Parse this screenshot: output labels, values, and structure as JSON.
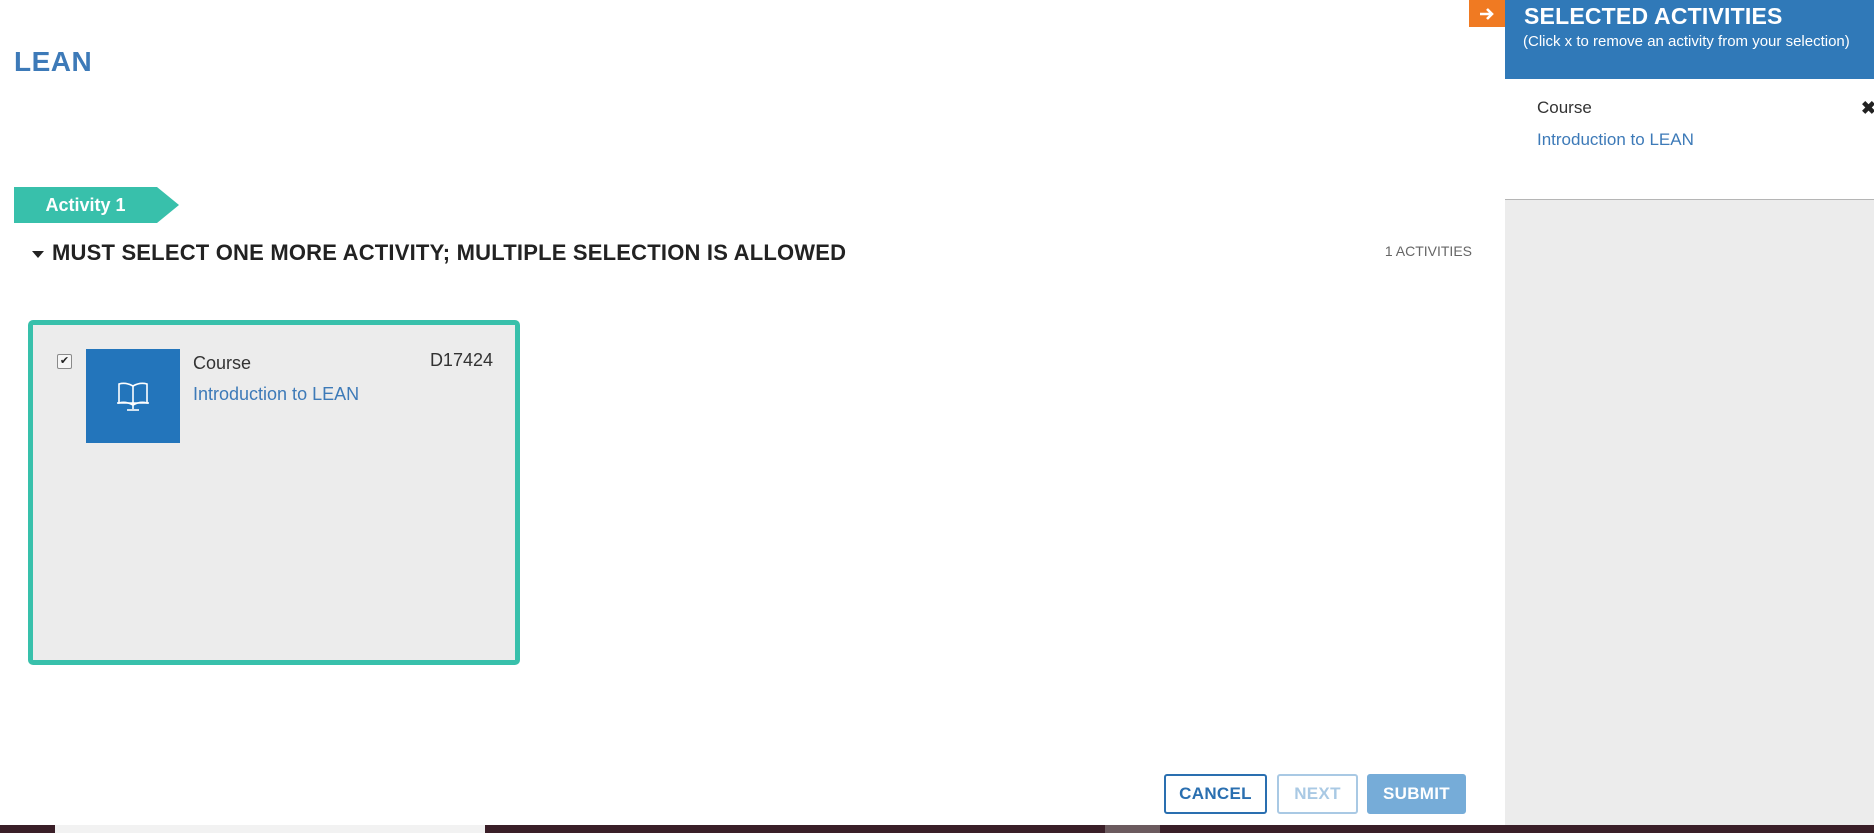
{
  "page": {
    "title": "LEAN"
  },
  "activity_tag": "Activity 1",
  "group": {
    "title": "MUST SELECT ONE MORE ACTIVITY; MULTIPLE SELECTION IS ALLOWED",
    "count": "1 ACTIVITIES"
  },
  "card": {
    "checked": true,
    "check_mark": "✔",
    "type": "Course",
    "code": "D17424",
    "title": "Introduction to LEAN",
    "icon": "book-monitor-icon"
  },
  "buttons": {
    "cancel": "CANCEL",
    "next": "NEXT",
    "submit": "SUBMIT"
  },
  "sidebar": {
    "title": "SELECTED ACTIVITIES",
    "subtitle": "(Click x to remove an activity from your selection)",
    "toggle_icon": "arrow-right-icon",
    "items": [
      {
        "type": "Course",
        "title": "Introduction to LEAN",
        "remove": "✖"
      }
    ]
  },
  "colors": {
    "accent_teal": "#38c0ab",
    "brand_blue": "#3079b8",
    "link_blue": "#3d7ab8",
    "orange": "#f07a22"
  }
}
